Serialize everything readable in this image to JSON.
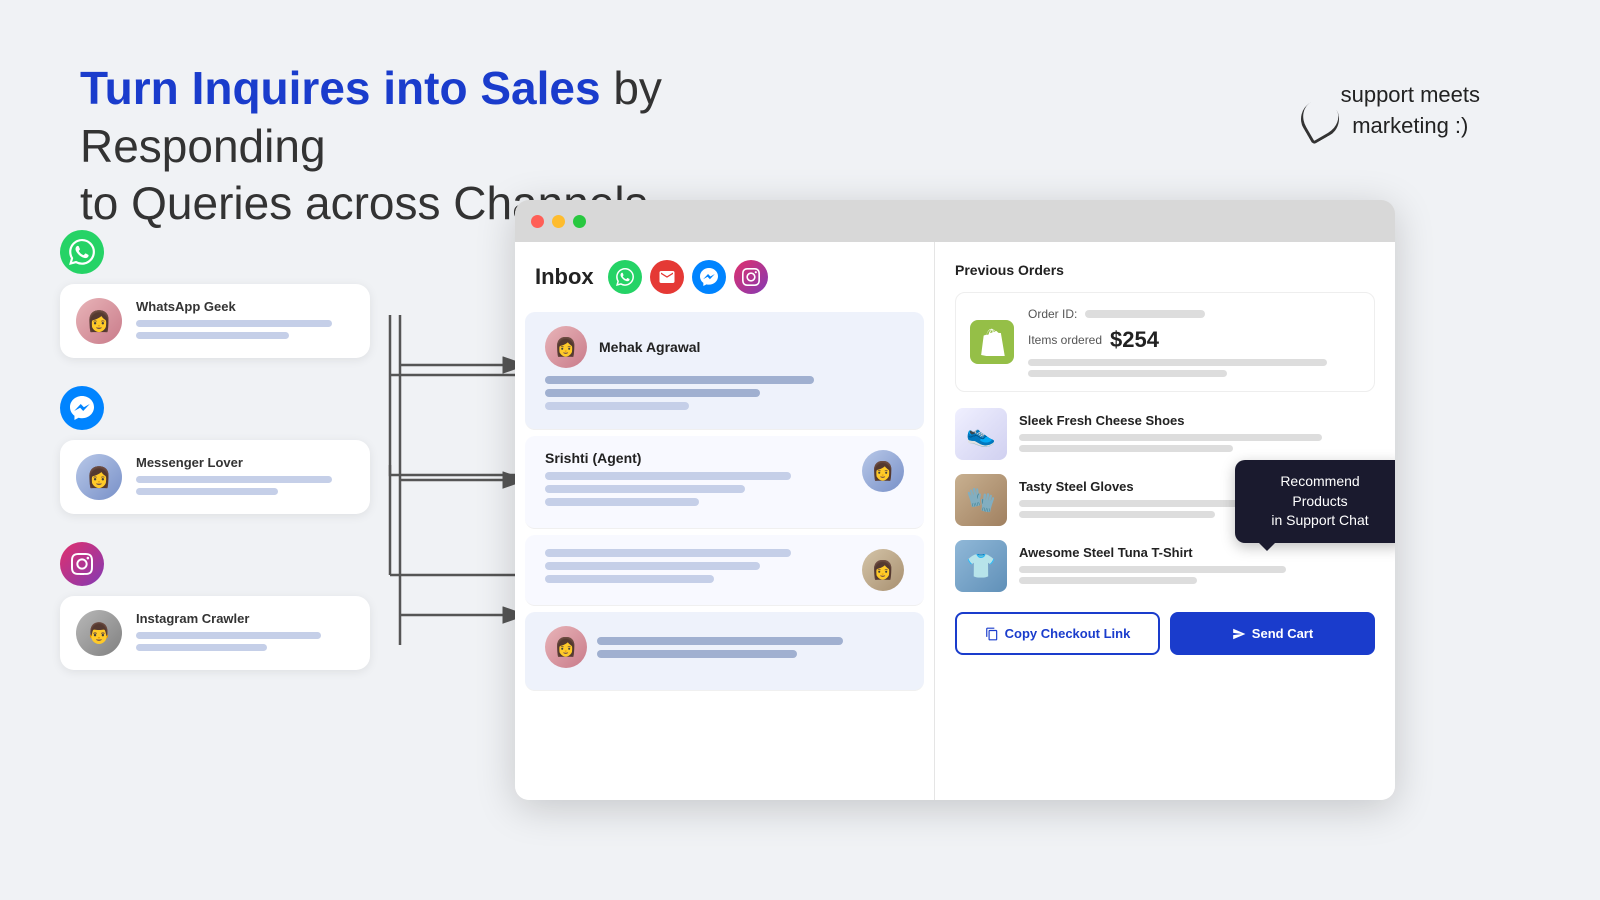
{
  "headline": {
    "bold_part": "Turn Inquires into Sales",
    "normal_part": " by Responding\nto Queries across Channels"
  },
  "support_note": {
    "line1": "support meets",
    "line2": "marketing :)"
  },
  "channels": [
    {
      "platform": "whatsapp",
      "icon": "💬",
      "bg": "#25d366",
      "name": "WhatsApp Geek",
      "avatar_class": "person-female-1",
      "avatar_emoji": "👩"
    },
    {
      "platform": "messenger",
      "icon": "💬",
      "bg": "#0084ff",
      "name": "Messenger Lover",
      "avatar_class": "person-female-2",
      "avatar_emoji": "👩"
    },
    {
      "platform": "instagram",
      "icon": "📷",
      "bg": "#e1306c",
      "name": "Instagram Crawler",
      "avatar_class": "person-male-1",
      "avatar_emoji": "👨"
    }
  ],
  "browser": {
    "inbox_title": "Inbox",
    "inbox_icons": [
      "whatsapp",
      "email",
      "messenger",
      "instagram"
    ],
    "chats": [
      {
        "name": "Mehak Agrawal",
        "side": "left",
        "avatar_class": "person-female-1"
      },
      {
        "name": "Srishti (Agent)",
        "side": "right",
        "avatar_class": "person-female-2"
      },
      {
        "name": "",
        "side": "right",
        "avatar_class": "person-female-3"
      },
      {
        "name": "",
        "side": "left",
        "avatar_class": "person-female-1"
      }
    ]
  },
  "right_panel": {
    "previous_orders_label": "Previous Orders",
    "order": {
      "order_id_label": "Order ID:",
      "items_label": "Items ordered",
      "price": "$254"
    },
    "products": [
      {
        "name": "Sleek Fresh Cheese Shoes",
        "thumb_class": "shoe-thumb"
      },
      {
        "name": "Tasty Steel Gloves",
        "thumb_class": "glove-thumb"
      },
      {
        "name": "Awesome Steel Tuna T-Shirt",
        "thumb_class": "tshirt-thumb"
      }
    ],
    "tooltip": {
      "line1": "Recommend Products",
      "line2": "in Support Chat"
    },
    "btn_copy": "Copy Checkout Link",
    "btn_send": "Send Cart"
  }
}
